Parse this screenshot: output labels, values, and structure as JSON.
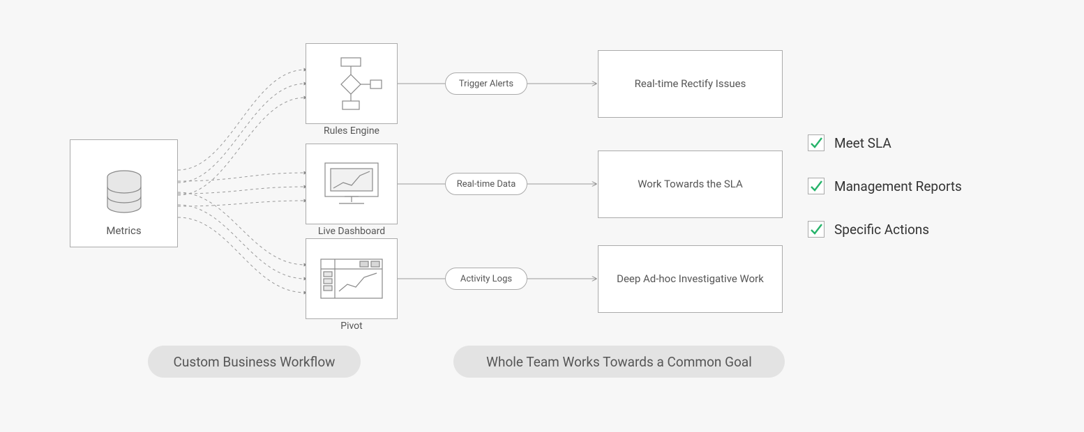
{
  "source": {
    "label": "Metrics"
  },
  "stages": [
    {
      "label": "Rules Engine",
      "pill": "Trigger Alerts",
      "result": "Real-time Rectify Issues"
    },
    {
      "label": "Live Dashboard",
      "pill": "Real-time Data",
      "result": "Work Towards the SLA"
    },
    {
      "label": "Pivot",
      "pill": "Activity Logs",
      "result": "Deep Ad-hoc Investigative Work"
    }
  ],
  "checklist": [
    {
      "label": "Meet SLA"
    },
    {
      "label": "Management Reports"
    },
    {
      "label": "Specific Actions"
    }
  ],
  "footer": {
    "left": "Custom Business Workflow",
    "right": "Whole Team Works Towards a Common Goal"
  }
}
